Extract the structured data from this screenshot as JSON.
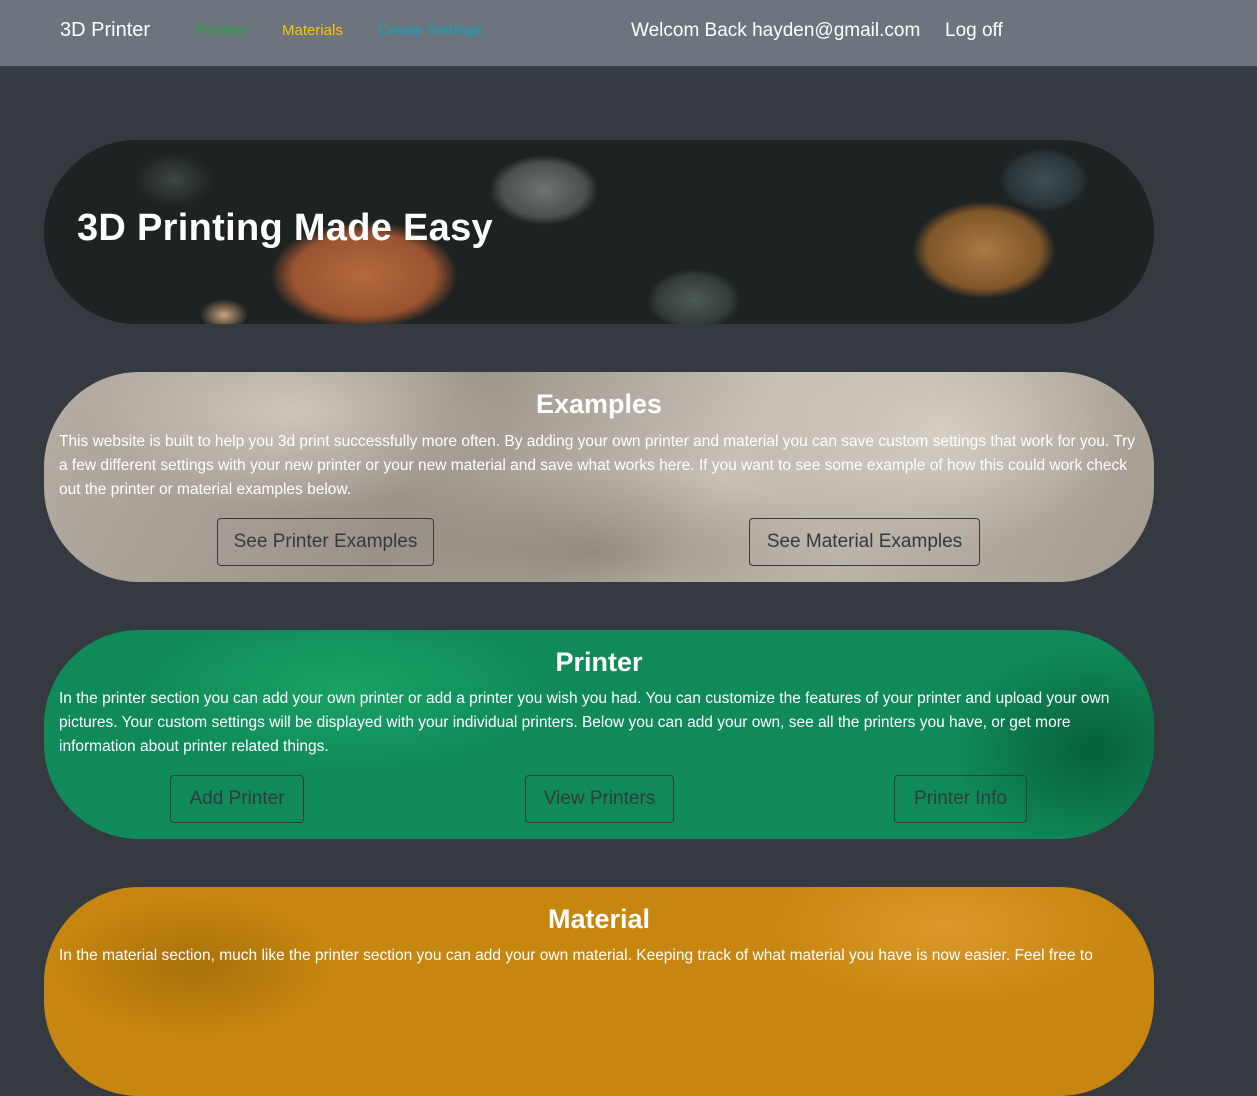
{
  "nav": {
    "brand": "3D Printer",
    "links": [
      "Printers",
      "Materials",
      "Create Settings"
    ],
    "welcome": "Welcom Back hayden@gmail.com",
    "logoff": "Log off"
  },
  "hero": {
    "title": "3D Printing Made Easy"
  },
  "examples": {
    "title": "Examples",
    "text": "This website is built to help you 3d print successfully more often. By adding your own printer and material you can save custom settings that work for you. Try a few different settings with your new printer or your new material and save what works here. If you want to see some example of how this could work check out the printer or material examples below.",
    "buttons": [
      "See Printer Examples",
      "See Material Examples"
    ]
  },
  "printer": {
    "title": "Printer",
    "text": "In the printer section you can add your own printer or add a printer you wish you had. You can customize the features of your printer and upload your own pictures. Your custom settings will be displayed with your individual printers. Below you can add your own, see all the printers you have, or get more information about printer related things.",
    "buttons": [
      "Add Printer",
      "View Printers",
      "Printer Info"
    ]
  },
  "material": {
    "title": "Material",
    "text": "In the material section, much like the printer section you can add your own material. Keeping track of what material you have is now easier. Feel free to"
  },
  "colors": {
    "navbar": "#6c757d",
    "page_background": "#343a40",
    "printers_link": "#28a745",
    "materials_link": "#ffc107",
    "settings_link": "#17a2b8",
    "printer_section": "#0f8a58",
    "material_section": "#c6860f"
  }
}
